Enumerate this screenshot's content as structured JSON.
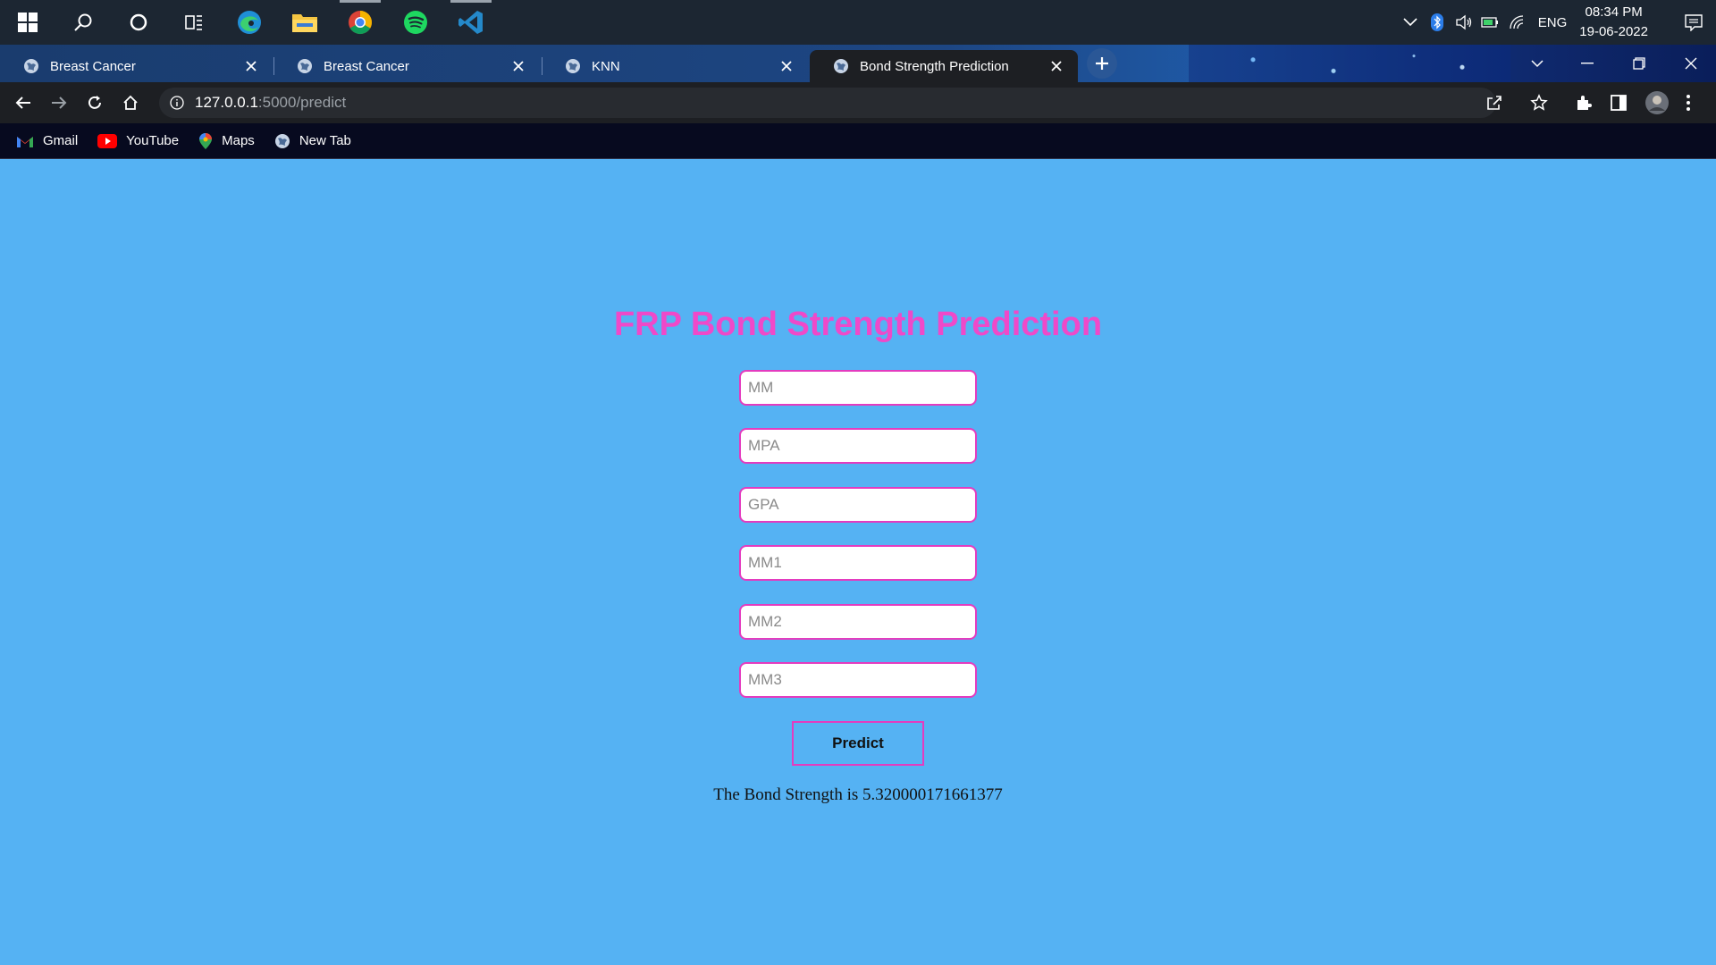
{
  "taskbar": {
    "icons": [
      "windows-start-icon",
      "search-icon",
      "cortana-icon",
      "task-view-icon",
      "edge-icon",
      "file-explorer-icon",
      "chrome-icon",
      "spotify-icon",
      "vscode-icon"
    ],
    "language": "ENG",
    "time": "08:34 PM",
    "date": "19-06-2022"
  },
  "tabs": [
    {
      "label": "Breast Cancer",
      "active": false
    },
    {
      "label": "Breast Cancer",
      "active": false
    },
    {
      "label": "KNN",
      "active": false
    },
    {
      "label": "Bond Strength Prediction",
      "active": true
    }
  ],
  "address_bar": {
    "host": "127.0.0.1",
    "path": ":5000/predict"
  },
  "bookmarks": [
    {
      "label": "Gmail"
    },
    {
      "label": "YouTube"
    },
    {
      "label": "Maps"
    },
    {
      "label": "New Tab"
    }
  ],
  "page": {
    "title": "FRP Bond Strength Prediction",
    "title_color": "#ef49c9",
    "background_color": "#55b2f3",
    "fields": [
      {
        "placeholder": "MM",
        "value": ""
      },
      {
        "placeholder": "MPA",
        "value": ""
      },
      {
        "placeholder": "GPA",
        "value": ""
      },
      {
        "placeholder": "MM1",
        "value": ""
      },
      {
        "placeholder": "MM2",
        "value": ""
      },
      {
        "placeholder": "MM3",
        "value": ""
      }
    ],
    "predict_label": "Predict",
    "result_text": "The Bond Strength is 5.320000171661377"
  }
}
